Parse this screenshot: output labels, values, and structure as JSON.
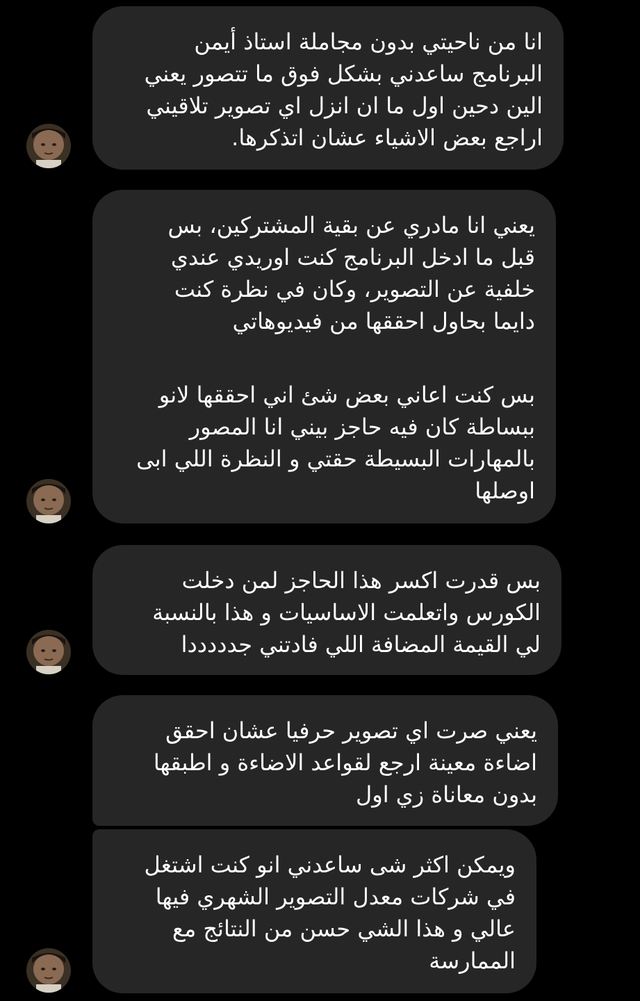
{
  "theme": {
    "background": "#000000",
    "bubble_color": "#262626",
    "text_color": "#ffffff"
  },
  "messages": [
    {
      "sender": "other",
      "avatar_icon": "user-avatar",
      "paragraphs": [
        [
          "انا من ناحيتي بدون مجاملة استاذ أيمن",
          "البرنامج ساعدني بشكل فوق ما تتصور يعني",
          "الين دحين اول ما ان انزل اي تصوير تلاقيني",
          "اراجع بعض الاشياء عشان اتذكرها."
        ]
      ]
    },
    {
      "sender": "other",
      "avatar_icon": "user-avatar",
      "paragraphs": [
        [
          "يعني انا مادري عن بقية المشتركين، بس",
          "قبل ما ادخل البرنامج كنت اوريدي عندي",
          "خلفية عن التصوير، وكان في نظرة كنت",
          "دايما بحاول احققها من فيديوهاتي"
        ],
        [
          "بس كنت اعاني بعض شئ اني احققها لانو",
          "ببساطة كان فيه حاجز بيني انا المصور",
          "بالمهارات البسيطة حقتي و النظرة اللي ابى",
          "اوصلها"
        ]
      ]
    },
    {
      "sender": "other",
      "avatar_icon": "user-avatar",
      "paragraphs": [
        [
          "بس قدرت اكسر هذا الحاجز لمن دخلت",
          "الكورس واتعلمت الاساسيات و هذا بالنسبة",
          "لي القيمة المضافة اللي فادتني جدددددا"
        ]
      ]
    },
    {
      "sender": "other",
      "avatar_icon": null,
      "paragraphs": [
        [
          "يعني صرت اي تصوير حرفيا عشان احقق",
          "اضاءة معينة ارجع لقواعد الاضاءة و اطبقها",
          "بدون معاناة زي اول"
        ]
      ]
    },
    {
      "sender": "other",
      "avatar_icon": "user-avatar",
      "paragraphs": [
        [
          "ويمكن اكثر شى ساعدني انو كنت اشتغل",
          "في شركات معدل التصوير الشهري فيها",
          "عالي و هذا الشي حسن من النتائج مع",
          "الممارسة"
        ]
      ]
    }
  ]
}
